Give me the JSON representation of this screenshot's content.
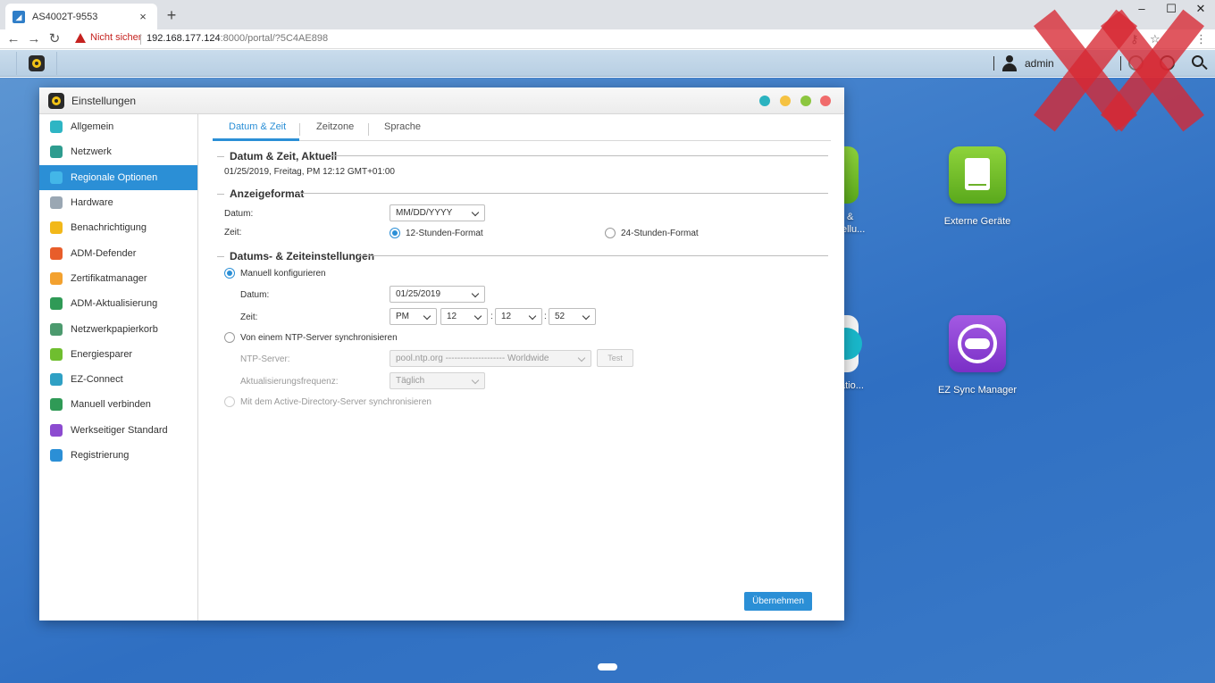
{
  "browser": {
    "tab_title": "AS4002T-9553",
    "tab_close": "×",
    "new_tab": "+",
    "url_warning": "Nicht sicher",
    "url_host": "192.168.177.124",
    "url_rest": ":8000/portal/?5C4AE898",
    "win_minimize": "–",
    "win_maximize": "☐",
    "win_close": "✕"
  },
  "taskbar": {
    "user_name": "admin"
  },
  "desktop": {
    "icons": [
      {
        "label": "Externe Geräte"
      },
      {
        "label": "EZ Sync Manager"
      }
    ],
    "partial_labels": [
      "&",
      "ellu...",
      "atio..."
    ]
  },
  "window": {
    "title": "Einstellungen",
    "dots": [
      "#2bb3c0",
      "#f5c242",
      "#8cc63f",
      "#f06b6b"
    ]
  },
  "sidebar": {
    "items": [
      {
        "label": "Allgemein",
        "color": "#2eb5c4"
      },
      {
        "label": "Netzwerk",
        "color": "#2e9c8f"
      },
      {
        "label": "Regionale Optionen",
        "color": "#43b6e8"
      },
      {
        "label": "Hardware",
        "color": "#9aa7b3"
      },
      {
        "label": "Benachrichtigung",
        "color": "#f2b81a"
      },
      {
        "label": "ADM-Defender",
        "color": "#e85d2a"
      },
      {
        "label": "Zertifikatmanager",
        "color": "#f3a12f"
      },
      {
        "label": "ADM-Aktualisierung",
        "color": "#2f9a56"
      },
      {
        "label": "Netzwerkpapierkorb",
        "color": "#4c9a6e"
      },
      {
        "label": "Energiesparer",
        "color": "#6fbe2f"
      },
      {
        "label": "EZ-Connect",
        "color": "#2fa0c4"
      },
      {
        "label": "Manuell verbinden",
        "color": "#2f9a56"
      },
      {
        "label": "Werkseitiger Standard",
        "color": "#8c4bd0"
      },
      {
        "label": "Registrierung",
        "color": "#2b8fd6"
      }
    ]
  },
  "tabs": [
    "Datum & Zeit",
    "Zeitzone",
    "Sprache"
  ],
  "current": {
    "heading": "Datum & Zeit, Aktuell",
    "value": "01/25/2019, Freitag, PM 12:12 GMT+01:00"
  },
  "display_format": {
    "heading": "Anzeigeformat",
    "date_label": "Datum:",
    "date_format": "MM/DD/YYYY",
    "time_label": "Zeit:",
    "option_12h": "12-Stunden-Format",
    "option_24h": "24-Stunden-Format"
  },
  "settings": {
    "heading": "Datums- & Zeiteinstellungen",
    "manual_label": "Manuell konfigurieren",
    "date_label": "Datum:",
    "date_value": "01/25/2019",
    "time_label": "Zeit:",
    "ampm": "PM",
    "hour": "12",
    "minute": "12",
    "second": "52",
    "colon": ":",
    "ntp_label": "Von einem NTP-Server synchronisieren",
    "ntp_server_label": "NTP-Server:",
    "ntp_server_value": "pool.ntp.org -------------------- Worldwide",
    "test_label": "Test",
    "freq_label": "Aktualisierungsfrequenz:",
    "freq_value": "Täglich",
    "ad_label": "Mit dem Active-Directory-Server synchronisieren"
  },
  "apply_label": "Übernehmen"
}
